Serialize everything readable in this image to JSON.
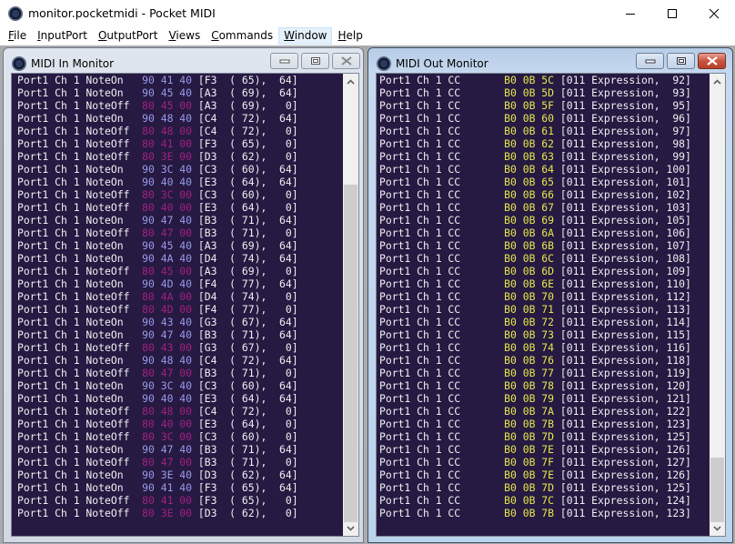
{
  "window": {
    "title": "monitor.pocketmidi - Pocket MIDI",
    "icon": "midi-port-icon",
    "controls": [
      "minimize-icon",
      "maximize-icon",
      "close-icon"
    ]
  },
  "menubar": {
    "items": [
      {
        "mnemonic": "F",
        "rest": "ile",
        "active": false
      },
      {
        "mnemonic": "I",
        "rest": "nputPort",
        "active": false
      },
      {
        "mnemonic": "O",
        "rest": "utputPort",
        "active": false
      },
      {
        "mnemonic": "V",
        "rest": "iews",
        "active": false
      },
      {
        "mnemonic": "C",
        "rest": "ommands",
        "active": false
      },
      {
        "mnemonic": "W",
        "rest": "indow",
        "active": true
      },
      {
        "mnemonic": "H",
        "rest": "elp",
        "active": false
      }
    ]
  },
  "colors": {
    "console_bg": "#261a43",
    "text": "#f0f0f0",
    "note_on_hex": "#9a9ae8",
    "note_off_hex": "#a1217f",
    "cc_hex": "#e8e84c"
  },
  "midi_in": {
    "title": "MIDI In Monitor",
    "scroll_thumb": {
      "start_fraction": 0.24,
      "end_fraction": 0.97
    },
    "lines": [
      {
        "prefix": "Port1 Ch 1 NoteOn   ",
        "hex": "90 41 40",
        "kind": "on",
        "suffix": " [F3  ( 65),  64]"
      },
      {
        "prefix": "Port1 Ch 1 NoteOn   ",
        "hex": "90 45 40",
        "kind": "on",
        "suffix": " [A3  ( 69),  64]"
      },
      {
        "prefix": "Port1 Ch 1 NoteOff  ",
        "hex": "80 45 00",
        "kind": "off",
        "suffix": " [A3  ( 69),   0]"
      },
      {
        "prefix": "Port1 Ch 1 NoteOn   ",
        "hex": "90 48 40",
        "kind": "on",
        "suffix": " [C4  ( 72),  64]"
      },
      {
        "prefix": "Port1 Ch 1 NoteOff  ",
        "hex": "80 48 00",
        "kind": "off",
        "suffix": " [C4  ( 72),   0]"
      },
      {
        "prefix": "Port1 Ch 1 NoteOff  ",
        "hex": "80 41 00",
        "kind": "off",
        "suffix": " [F3  ( 65),   0]"
      },
      {
        "prefix": "Port1 Ch 1 NoteOff  ",
        "hex": "80 3E 00",
        "kind": "off",
        "suffix": " [D3  ( 62),   0]"
      },
      {
        "prefix": "Port1 Ch 1 NoteOn   ",
        "hex": "90 3C 40",
        "kind": "on",
        "suffix": " [C3  ( 60),  64]"
      },
      {
        "prefix": "Port1 Ch 1 NoteOn   ",
        "hex": "90 40 40",
        "kind": "on",
        "suffix": " [E3  ( 64),  64]"
      },
      {
        "prefix": "Port1 Ch 1 NoteOff  ",
        "hex": "80 3C 00",
        "kind": "off",
        "suffix": " [C3  ( 60),   0]"
      },
      {
        "prefix": "Port1 Ch 1 NoteOff  ",
        "hex": "80 40 00",
        "kind": "off",
        "suffix": " [E3  ( 64),   0]"
      },
      {
        "prefix": "Port1 Ch 1 NoteOn   ",
        "hex": "90 47 40",
        "kind": "on",
        "suffix": " [B3  ( 71),  64]"
      },
      {
        "prefix": "Port1 Ch 1 NoteOff  ",
        "hex": "80 47 00",
        "kind": "off",
        "suffix": " [B3  ( 71),   0]"
      },
      {
        "prefix": "Port1 Ch 1 NoteOn   ",
        "hex": "90 45 40",
        "kind": "on",
        "suffix": " [A3  ( 69),  64]"
      },
      {
        "prefix": "Port1 Ch 1 NoteOn   ",
        "hex": "90 4A 40",
        "kind": "on",
        "suffix": " [D4  ( 74),  64]"
      },
      {
        "prefix": "Port1 Ch 1 NoteOff  ",
        "hex": "80 45 00",
        "kind": "off",
        "suffix": " [A3  ( 69),   0]"
      },
      {
        "prefix": "Port1 Ch 1 NoteOn   ",
        "hex": "90 4D 40",
        "kind": "on",
        "suffix": " [F4  ( 77),  64]"
      },
      {
        "prefix": "Port1 Ch 1 NoteOff  ",
        "hex": "80 4A 00",
        "kind": "off",
        "suffix": " [D4  ( 74),   0]"
      },
      {
        "prefix": "Port1 Ch 1 NoteOff  ",
        "hex": "80 4D 00",
        "kind": "off",
        "suffix": " [F4  ( 77),   0]"
      },
      {
        "prefix": "Port1 Ch 1 NoteOn   ",
        "hex": "90 43 40",
        "kind": "on",
        "suffix": " [G3  ( 67),  64]"
      },
      {
        "prefix": "Port1 Ch 1 NoteOn   ",
        "hex": "90 47 40",
        "kind": "on",
        "suffix": " [B3  ( 71),  64]"
      },
      {
        "prefix": "Port1 Ch 1 NoteOff  ",
        "hex": "80 43 00",
        "kind": "off",
        "suffix": " [G3  ( 67),   0]"
      },
      {
        "prefix": "Port1 Ch 1 NoteOn   ",
        "hex": "90 48 40",
        "kind": "on",
        "suffix": " [C4  ( 72),  64]"
      },
      {
        "prefix": "Port1 Ch 1 NoteOff  ",
        "hex": "80 47 00",
        "kind": "off",
        "suffix": " [B3  ( 71),   0]"
      },
      {
        "prefix": "Port1 Ch 1 NoteOn   ",
        "hex": "90 3C 40",
        "kind": "on",
        "suffix": " [C3  ( 60),  64]"
      },
      {
        "prefix": "Port1 Ch 1 NoteOn   ",
        "hex": "90 40 40",
        "kind": "on",
        "suffix": " [E3  ( 64),  64]"
      },
      {
        "prefix": "Port1 Ch 1 NoteOff  ",
        "hex": "80 48 00",
        "kind": "off",
        "suffix": " [C4  ( 72),   0]"
      },
      {
        "prefix": "Port1 Ch 1 NoteOff  ",
        "hex": "80 40 00",
        "kind": "off",
        "suffix": " [E3  ( 64),   0]"
      },
      {
        "prefix": "Port1 Ch 1 NoteOff  ",
        "hex": "80 3C 00",
        "kind": "off",
        "suffix": " [C3  ( 60),   0]"
      },
      {
        "prefix": "Port1 Ch 1 NoteOn   ",
        "hex": "90 47 40",
        "kind": "on",
        "suffix": " [B3  ( 71),  64]"
      },
      {
        "prefix": "Port1 Ch 1 NoteOff  ",
        "hex": "80 47 00",
        "kind": "off",
        "suffix": " [B3  ( 71),   0]"
      },
      {
        "prefix": "Port1 Ch 1 NoteOn   ",
        "hex": "90 3E 40",
        "kind": "on",
        "suffix": " [D3  ( 62),  64]"
      },
      {
        "prefix": "Port1 Ch 1 NoteOn   ",
        "hex": "90 41 40",
        "kind": "on",
        "suffix": " [F3  ( 65),  64]"
      },
      {
        "prefix": "Port1 Ch 1 NoteOff  ",
        "hex": "80 41 00",
        "kind": "off",
        "suffix": " [F3  ( 65),   0]"
      },
      {
        "prefix": "Port1 Ch 1 NoteOff  ",
        "hex": "80 3E 00",
        "kind": "off",
        "suffix": " [D3  ( 62),   0]"
      }
    ]
  },
  "midi_out": {
    "title": "MIDI Out Monitor",
    "scroll_thumb": {
      "start_fraction": 0.83,
      "end_fraction": 0.97
    },
    "lines": [
      {
        "prefix": "Port1 Ch 1 CC       ",
        "hex": "B0 0B 5C",
        "kind": "cc",
        "suffix": " [011 Expression,  92]"
      },
      {
        "prefix": "Port1 Ch 1 CC       ",
        "hex": "B0 0B 5D",
        "kind": "cc",
        "suffix": " [011 Expression,  93]"
      },
      {
        "prefix": "Port1 Ch 1 CC       ",
        "hex": "B0 0B 5F",
        "kind": "cc",
        "suffix": " [011 Expression,  95]"
      },
      {
        "prefix": "Port1 Ch 1 CC       ",
        "hex": "B0 0B 60",
        "kind": "cc",
        "suffix": " [011 Expression,  96]"
      },
      {
        "prefix": "Port1 Ch 1 CC       ",
        "hex": "B0 0B 61",
        "kind": "cc",
        "suffix": " [011 Expression,  97]"
      },
      {
        "prefix": "Port1 Ch 1 CC       ",
        "hex": "B0 0B 62",
        "kind": "cc",
        "suffix": " [011 Expression,  98]"
      },
      {
        "prefix": "Port1 Ch 1 CC       ",
        "hex": "B0 0B 63",
        "kind": "cc",
        "suffix": " [011 Expression,  99]"
      },
      {
        "prefix": "Port1 Ch 1 CC       ",
        "hex": "B0 0B 64",
        "kind": "cc",
        "suffix": " [011 Expression, 100]"
      },
      {
        "prefix": "Port1 Ch 1 CC       ",
        "hex": "B0 0B 65",
        "kind": "cc",
        "suffix": " [011 Expression, 101]"
      },
      {
        "prefix": "Port1 Ch 1 CC       ",
        "hex": "B0 0B 66",
        "kind": "cc",
        "suffix": " [011 Expression, 102]"
      },
      {
        "prefix": "Port1 Ch 1 CC       ",
        "hex": "B0 0B 67",
        "kind": "cc",
        "suffix": " [011 Expression, 103]"
      },
      {
        "prefix": "Port1 Ch 1 CC       ",
        "hex": "B0 0B 69",
        "kind": "cc",
        "suffix": " [011 Expression, 105]"
      },
      {
        "prefix": "Port1 Ch 1 CC       ",
        "hex": "B0 0B 6A",
        "kind": "cc",
        "suffix": " [011 Expression, 106]"
      },
      {
        "prefix": "Port1 Ch 1 CC       ",
        "hex": "B0 0B 6B",
        "kind": "cc",
        "suffix": " [011 Expression, 107]"
      },
      {
        "prefix": "Port1 Ch 1 CC       ",
        "hex": "B0 0B 6C",
        "kind": "cc",
        "suffix": " [011 Expression, 108]"
      },
      {
        "prefix": "Port1 Ch 1 CC       ",
        "hex": "B0 0B 6D",
        "kind": "cc",
        "suffix": " [011 Expression, 109]"
      },
      {
        "prefix": "Port1 Ch 1 CC       ",
        "hex": "B0 0B 6E",
        "kind": "cc",
        "suffix": " [011 Expression, 110]"
      },
      {
        "prefix": "Port1 Ch 1 CC       ",
        "hex": "B0 0B 70",
        "kind": "cc",
        "suffix": " [011 Expression, 112]"
      },
      {
        "prefix": "Port1 Ch 1 CC       ",
        "hex": "B0 0B 71",
        "kind": "cc",
        "suffix": " [011 Expression, 113]"
      },
      {
        "prefix": "Port1 Ch 1 CC       ",
        "hex": "B0 0B 72",
        "kind": "cc",
        "suffix": " [011 Expression, 114]"
      },
      {
        "prefix": "Port1 Ch 1 CC       ",
        "hex": "B0 0B 73",
        "kind": "cc",
        "suffix": " [011 Expression, 115]"
      },
      {
        "prefix": "Port1 Ch 1 CC       ",
        "hex": "B0 0B 74",
        "kind": "cc",
        "suffix": " [011 Expression, 116]"
      },
      {
        "prefix": "Port1 Ch 1 CC       ",
        "hex": "B0 0B 76",
        "kind": "cc",
        "suffix": " [011 Expression, 118]"
      },
      {
        "prefix": "Port1 Ch 1 CC       ",
        "hex": "B0 0B 77",
        "kind": "cc",
        "suffix": " [011 Expression, 119]"
      },
      {
        "prefix": "Port1 Ch 1 CC       ",
        "hex": "B0 0B 78",
        "kind": "cc",
        "suffix": " [011 Expression, 120]"
      },
      {
        "prefix": "Port1 Ch 1 CC       ",
        "hex": "B0 0B 79",
        "kind": "cc",
        "suffix": " [011 Expression, 121]"
      },
      {
        "prefix": "Port1 Ch 1 CC       ",
        "hex": "B0 0B 7A",
        "kind": "cc",
        "suffix": " [011 Expression, 122]"
      },
      {
        "prefix": "Port1 Ch 1 CC       ",
        "hex": "B0 0B 7B",
        "kind": "cc",
        "suffix": " [011 Expression, 123]"
      },
      {
        "prefix": "Port1 Ch 1 CC       ",
        "hex": "B0 0B 7D",
        "kind": "cc",
        "suffix": " [011 Expression, 125]"
      },
      {
        "prefix": "Port1 Ch 1 CC       ",
        "hex": "B0 0B 7E",
        "kind": "cc",
        "suffix": " [011 Expression, 126]"
      },
      {
        "prefix": "Port1 Ch 1 CC       ",
        "hex": "B0 0B 7F",
        "kind": "cc",
        "suffix": " [011 Expression, 127]"
      },
      {
        "prefix": "Port1 Ch 1 CC       ",
        "hex": "B0 0B 7E",
        "kind": "cc",
        "suffix": " [011 Expression, 126]"
      },
      {
        "prefix": "Port1 Ch 1 CC       ",
        "hex": "B0 0B 7D",
        "kind": "cc",
        "suffix": " [011 Expression, 125]"
      },
      {
        "prefix": "Port1 Ch 1 CC       ",
        "hex": "B0 0B 7C",
        "kind": "cc",
        "suffix": " [011 Expression, 124]"
      },
      {
        "prefix": "Port1 Ch 1 CC       ",
        "hex": "B0 0B 7B",
        "kind": "cc",
        "suffix": " [011 Expression, 123]"
      }
    ]
  }
}
